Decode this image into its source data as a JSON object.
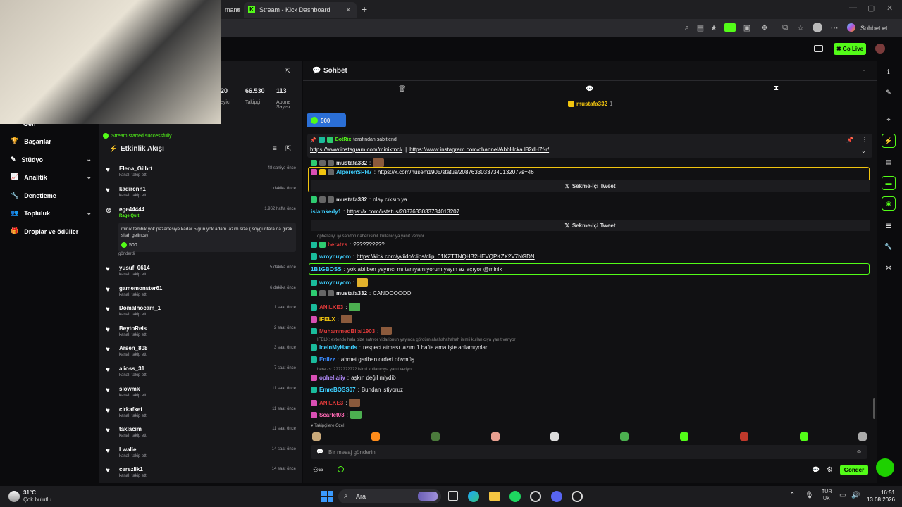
{
  "browser": {
    "tab_partial_label": "mand",
    "active_tab_label": "Stream - Kick Dashboard",
    "new_tab_symbol": "+",
    "profile_label": "Sohbet et"
  },
  "topnav": {
    "go_live_label": "Go Live"
  },
  "stats": {
    "viewers_partial_value": "20",
    "viewers_partial_label": "eyici",
    "followers_value": "66.530",
    "followers_label": "Takipçi",
    "subs_value": "113",
    "subs_label": "Abone Sayısı",
    "toast_text": "Stream started successfully"
  },
  "sidebar": {
    "partial_label": "Gen",
    "items": [
      {
        "label": "Başarılar",
        "has_chevron": false
      },
      {
        "label": "Stüdyo",
        "has_chevron": true
      },
      {
        "label": "Analitik",
        "has_chevron": true
      },
      {
        "label": "Denetleme",
        "has_chevron": false
      },
      {
        "label": "Topluluk",
        "has_chevron": true
      },
      {
        "label": "Droplar ve ödüller",
        "has_chevron": false
      }
    ]
  },
  "activity": {
    "title": "Etkinlik Akışı",
    "events": [
      {
        "user": "Elena_Gilbrt",
        "sub": "kanalı takip etti",
        "time": "48 saniye önce"
      },
      {
        "user": "kadircnn1",
        "sub": "kanalı takip etti",
        "time": "1 dakika önce"
      },
      {
        "user": "ege44444",
        "sub": "Rage Quit",
        "time": "1.962 hafta önce"
      },
      {
        "user": "yusuf_0614",
        "sub": "kanalı takip etti",
        "time": "5 dakika önce"
      },
      {
        "user": "gamemonster61",
        "sub": "kanalı takip etti",
        "time": "6 dakika önce"
      },
      {
        "user": "Domalhocam_1",
        "sub": "kanalı takip etti",
        "time": "1 saat önce"
      },
      {
        "user": "BeytoReis",
        "sub": "kanalı takip etti",
        "time": "2 saat önce"
      },
      {
        "user": "Arsen_808",
        "sub": "kanalı takip etti",
        "time": "3 saat önce"
      },
      {
        "user": "alioss_31",
        "sub": "kanalı takip etti",
        "time": "7 saat önce"
      },
      {
        "user": "slowmk",
        "sub": "kanalı takip etti",
        "time": "11 saat önce"
      },
      {
        "user": "cirkafkef",
        "sub": "kanalı takip etti",
        "time": "11 saat önce"
      },
      {
        "user": "taklacim",
        "sub": "kanalı takip etti",
        "time": "11 saat önce"
      },
      {
        "user": "Lwalie",
        "sub": "kanalı takip etti",
        "time": "14 saat önce"
      },
      {
        "user": "cerezlik1",
        "sub": "kanalı takip etti",
        "time": "14 saat önce"
      }
    ],
    "ragequit_message": "minik tembik yok pazartesiye kadar 5 gün yok adam lazım size ( soyguntara da girek silah gelince)",
    "ragequit_amount": "500",
    "ragequit_sent": "gönderdi"
  },
  "chat": {
    "title": "Sohbet",
    "top_user": "mustafa332",
    "top_user_count": "1",
    "kicks_value": "500",
    "pinned_by": "BotRix",
    "pinned_suffix": "tarafından sabitlendi",
    "pinned_link1": "https://www.instagram.com/miniktncl/",
    "pinned_sep": "|",
    "pinned_link2": "https://www.instagram.com/channel/AbbHcka.l82dH7f-r/",
    "tweet_label": "Sekme-İçi Tweet",
    "messages": [
      {
        "user": "mustafa332",
        "text": "",
        "color": "#ffffff"
      },
      {
        "user": "AlperenSPH7",
        "text": "https://x.com/husem1905/status/2087633033734013207?s=46",
        "color": "#3fd0ff"
      },
      {
        "user": "mustafa332",
        "text": "olay cıksın ya",
        "color": "#ffffff"
      },
      {
        "user": "islamkedy1",
        "text": "https://x.com/i/status/2087633033734013207",
        "color": "#3fd0ff"
      },
      {
        "user": "beratzs",
        "text": "??????????",
        "color": "#e03a3a"
      },
      {
        "user": "wroynuyom",
        "text": "https://kick.com/yviido/clips/clip_01KZTTNQHB2HEVQPKZX2V7NGDN",
        "color": "#3fd0ff"
      },
      {
        "user": "1B1GBOSS",
        "text": "yok abi ben yayıncı mı tanıyamıyorum yayın az açıyor @minik",
        "color": "#3fd0ff"
      },
      {
        "user": "wroynuyom",
        "text": "",
        "color": "#3fd0ff"
      },
      {
        "user": "mustafa332",
        "text": "CANOOOOOO",
        "color": "#ffffff"
      },
      {
        "user": "ANILKE3",
        "text": "",
        "color": "#e03a3a"
      },
      {
        "user": "IFELX",
        "text": "",
        "color": "#f1c40f"
      },
      {
        "user": "MuhammedBilal1903",
        "text": "",
        "color": "#e03a3a"
      },
      {
        "user": "IceInMyHands",
        "text": "respect atması lazım 1 hafta ama işte anlamıyolar",
        "color": "#3fd0ff"
      },
      {
        "user": "Enilzz",
        "text": "ahmet gariban orderi dövmüş",
        "color": "#3a8bff"
      },
      {
        "user": "opheliaiiy",
        "text": "aşkın değil miydiö",
        "color": "#b58cff"
      },
      {
        "user": "EmreBOSS07",
        "text": "Bundan istiyoruz",
        "color": "#3fd0ff"
      },
      {
        "user": "ANILKE3",
        "text": "",
        "color": "#e03a3a"
      },
      {
        "user": "Scarlet03",
        "text": "",
        "color": "#ff69b4"
      }
    ],
    "reply1": "opheliaiiy: iyi sandon naber isimli kullanıcıya yanıt veriyor",
    "reply2": "IFELX: extendo hala bize satıyor vidarionun yayında gördüm ahahshahahah isimli kullanıcıya yanıt veriyor",
    "reply3": "beratzs: ?????????? isimli kullanıcıya yanıt veriyor",
    "followers_only_label": "Takipçilere Özel",
    "input_placeholder": "Bir mesaj gönderin",
    "send_label": "Gönder"
  },
  "taskbar": {
    "weather_temp": "31°C",
    "weather_desc": "Çok bulutlu",
    "search_label": "Ara",
    "lang_top": "TUR",
    "lang_bottom": "UK",
    "time": "16:51",
    "date": "13.08.2026"
  },
  "colors": {
    "kick_green": "#53fc18",
    "panel_bg": "#18181b",
    "highlight_border": "#53fc18"
  }
}
